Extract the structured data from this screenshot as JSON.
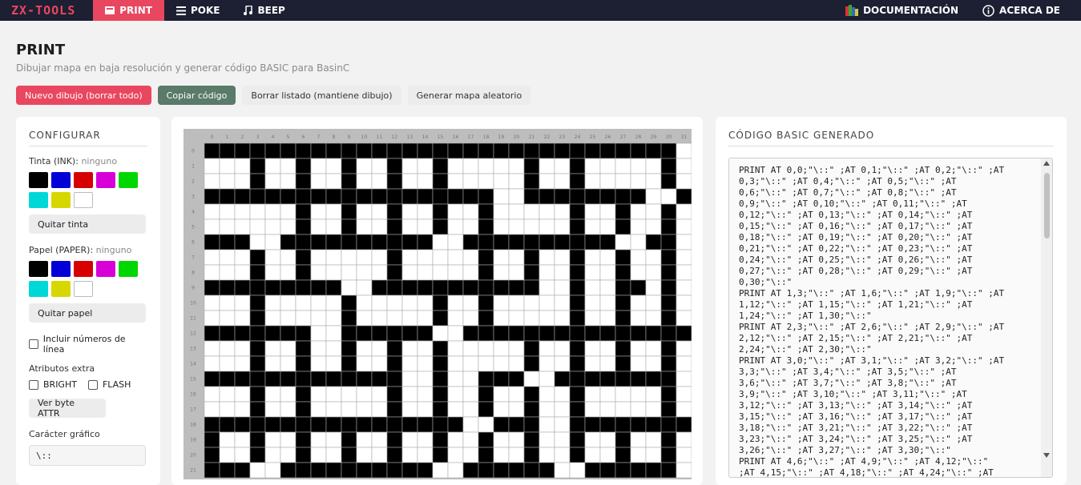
{
  "nav": {
    "brand": "ZX-TOOLS",
    "items": [
      {
        "label": "PRINT",
        "icon": "printer-icon",
        "active": true
      },
      {
        "label": "POKE",
        "icon": "menu-icon",
        "active": false
      },
      {
        "label": "BEEP",
        "icon": "music-note-icon",
        "active": false
      }
    ],
    "right": [
      {
        "label": "DOCUMENTACIÓN",
        "icon": "books-icon"
      },
      {
        "label": "ACERCA DE",
        "icon": "info-icon"
      }
    ]
  },
  "page": {
    "title": "PRINT",
    "subtitle": "Dibujar mapa en baja resolución y generar código BASIC para BasinC"
  },
  "actions": {
    "new_drawing": "Nuevo dibujo (borrar todo)",
    "copy_code": "Copiar código",
    "clear_listing": "Borrar listado (mantiene dibujo)",
    "random_map": "Generar mapa aleatorio"
  },
  "config": {
    "title": "CONFIGURAR",
    "ink_label": "Tinta (INK):",
    "ink_value": "ninguno",
    "ink_colors": [
      "#000000",
      "#0000d7",
      "#d70000",
      "#d700d7",
      "#00d700",
      "#00d7d7",
      "#d7d700",
      "#ffffff"
    ],
    "clear_ink": "Quitar tinta",
    "paper_label": "Papel (PAPER):",
    "paper_value": "ninguno",
    "paper_colors": [
      "#000000",
      "#0000d7",
      "#d70000",
      "#d700d7",
      "#00d700",
      "#00d7d7",
      "#d7d700",
      "#ffffff"
    ],
    "clear_paper": "Quitar papel",
    "include_line_numbers": "Incluir números de línea",
    "include_line_numbers_checked": false,
    "extra_attrs": "Atributos extra",
    "bright": "BRIGHT",
    "bright_checked": false,
    "flash": "FLASH",
    "flash_checked": false,
    "view_attr": "Ver byte ATTR",
    "graphic_char_label": "Carácter gráfico",
    "graphic_char_value": "\\::"
  },
  "code": {
    "title": "CÓDIGO BASIC GENERADO",
    "lines": [
      "PRINT AT 0,0;\"\\::\" ;AT 0,1;\"\\::\" ;AT 0,2;\"\\::\" ;AT",
      "0,3;\"\\::\" ;AT 0,4;\"\\::\" ;AT 0,5;\"\\::\" ;AT",
      "0,6;\"\\::\" ;AT 0,7;\"\\::\" ;AT 0,8;\"\\::\" ;AT",
      "0,9;\"\\::\" ;AT 0,10;\"\\::\" ;AT 0,11;\"\\::\" ;AT",
      "0,12;\"\\::\" ;AT 0,13;\"\\::\" ;AT 0,14;\"\\::\" ;AT",
      "0,15;\"\\::\" ;AT 0,16;\"\\::\" ;AT 0,17;\"\\::\" ;AT",
      "0,18;\"\\::\" ;AT 0,19;\"\\::\" ;AT 0,20;\"\\::\" ;AT",
      "0,21;\"\\::\" ;AT 0,22;\"\\::\" ;AT 0,23;\"\\::\" ;AT",
      "0,24;\"\\::\" ;AT 0,25;\"\\::\" ;AT 0,26;\"\\::\" ;AT",
      "0,27;\"\\::\" ;AT 0,28;\"\\::\" ;AT 0,29;\"\\::\" ;AT",
      "0,30;\"\\::\"",
      "PRINT AT 1,3;\"\\::\" ;AT 1,6;\"\\::\" ;AT 1,9;\"\\::\" ;AT",
      "1,12;\"\\::\" ;AT 1,15;\"\\::\" ;AT 1,21;\"\\::\" ;AT",
      "1,24;\"\\::\" ;AT 1,30;\"\\::\"",
      "PRINT AT 2,3;\"\\::\" ;AT 2,6;\"\\::\" ;AT 2,9;\"\\::\" ;AT",
      "2,12;\"\\::\" ;AT 2,15;\"\\::\" ;AT 2,21;\"\\::\" ;AT",
      "2,24;\"\\::\" ;AT 2,30;\"\\::\"",
      "PRINT AT 3,0;\"\\::\" ;AT 3,1;\"\\::\" ;AT 3,2;\"\\::\" ;AT",
      "3,3;\"\\::\" ;AT 3,4;\"\\::\" ;AT 3,5;\"\\::\" ;AT",
      "3,6;\"\\::\" ;AT 3,7;\"\\::\" ;AT 3,8;\"\\::\" ;AT",
      "3,9;\"\\::\" ;AT 3,10;\"\\::\" ;AT 3,11;\"\\::\" ;AT",
      "3,12;\"\\::\" ;AT 3,13;\"\\::\" ;AT 3,14;\"\\::\" ;AT",
      "3,15;\"\\::\" ;AT 3,16;\"\\::\" ;AT 3,17;\"\\::\" ;AT",
      "3,18;\"\\::\" ;AT 3,21;\"\\::\" ;AT 3,22;\"\\::\" ;AT",
      "3,23;\"\\::\" ;AT 3,24;\"\\::\" ;AT 3,25;\"\\::\" ;AT",
      "3,26;\"\\::\" ;AT 3,27;\"\\::\" ;AT 3,30;\"\\::\"",
      "PRINT AT 4,6;\"\\::\" ;AT 4,9;\"\\::\" ;AT 4,12;\"\\::\"",
      ";AT 4,15;\"\\::\" ;AT 4,18;\"\\::\" ;AT 4,24;\"\\::\" ;AT"
    ]
  },
  "grid": {
    "cols": 32,
    "rows": 22,
    "col_labels": [
      "0",
      "1",
      "2",
      "3",
      "4",
      "5",
      "6",
      "7",
      "8",
      "9",
      "10",
      "11",
      "12",
      "13",
      "14",
      "15",
      "16",
      "17",
      "18",
      "19",
      "20",
      "21",
      "22",
      "23",
      "24",
      "25",
      "26",
      "27",
      "28",
      "29",
      "30",
      "31"
    ],
    "row_labels": [
      "0",
      "1",
      "2",
      "3",
      "4",
      "5",
      "6",
      "7",
      "8",
      "9",
      "10",
      "11",
      "12",
      "13",
      "14",
      "15",
      "16",
      "17",
      "18",
      "19",
      "20",
      "21"
    ],
    "filled_rows": [
      "###############################.",
      "...#..#..#..#..#.....#..#.....#.",
      "...#..#..#..#..#.....#..#.....#.",
      "###################..########..#.",
      "......#..#..#..#..#.....#..#..#.",
      "......#..#..#..#..#.....#..#..#.",
      "###..##########..##########..##.",
      "...#..#.....#.....#..#..#..#..#.",
      "...#..#.....#.....#..#..#..#..#.",
      "#########..###########..#..##.#.",
      "...#.....#.....#..#.....#..#..#.",
      "...#.....#.....#..#.....#..#..#.",
      "#######..######..###############.",
      "...#..#..#..#..#.....#..#..#..#.",
      "...#..#..#..#..#.....#..#..#..#.",
      "#############..#..###..########.",
      "...#..#.....#..#..#..#..#.....#.",
      "...#..#.....#..#..#..#..#.....#.",
      "#################..###..########.",
      "#..#..#..#..#..#..#..#..#..#..#.",
      "#..#..#..#..#..#..#..#..#..#..#.",
      "###..##########..######..######."
    ]
  }
}
